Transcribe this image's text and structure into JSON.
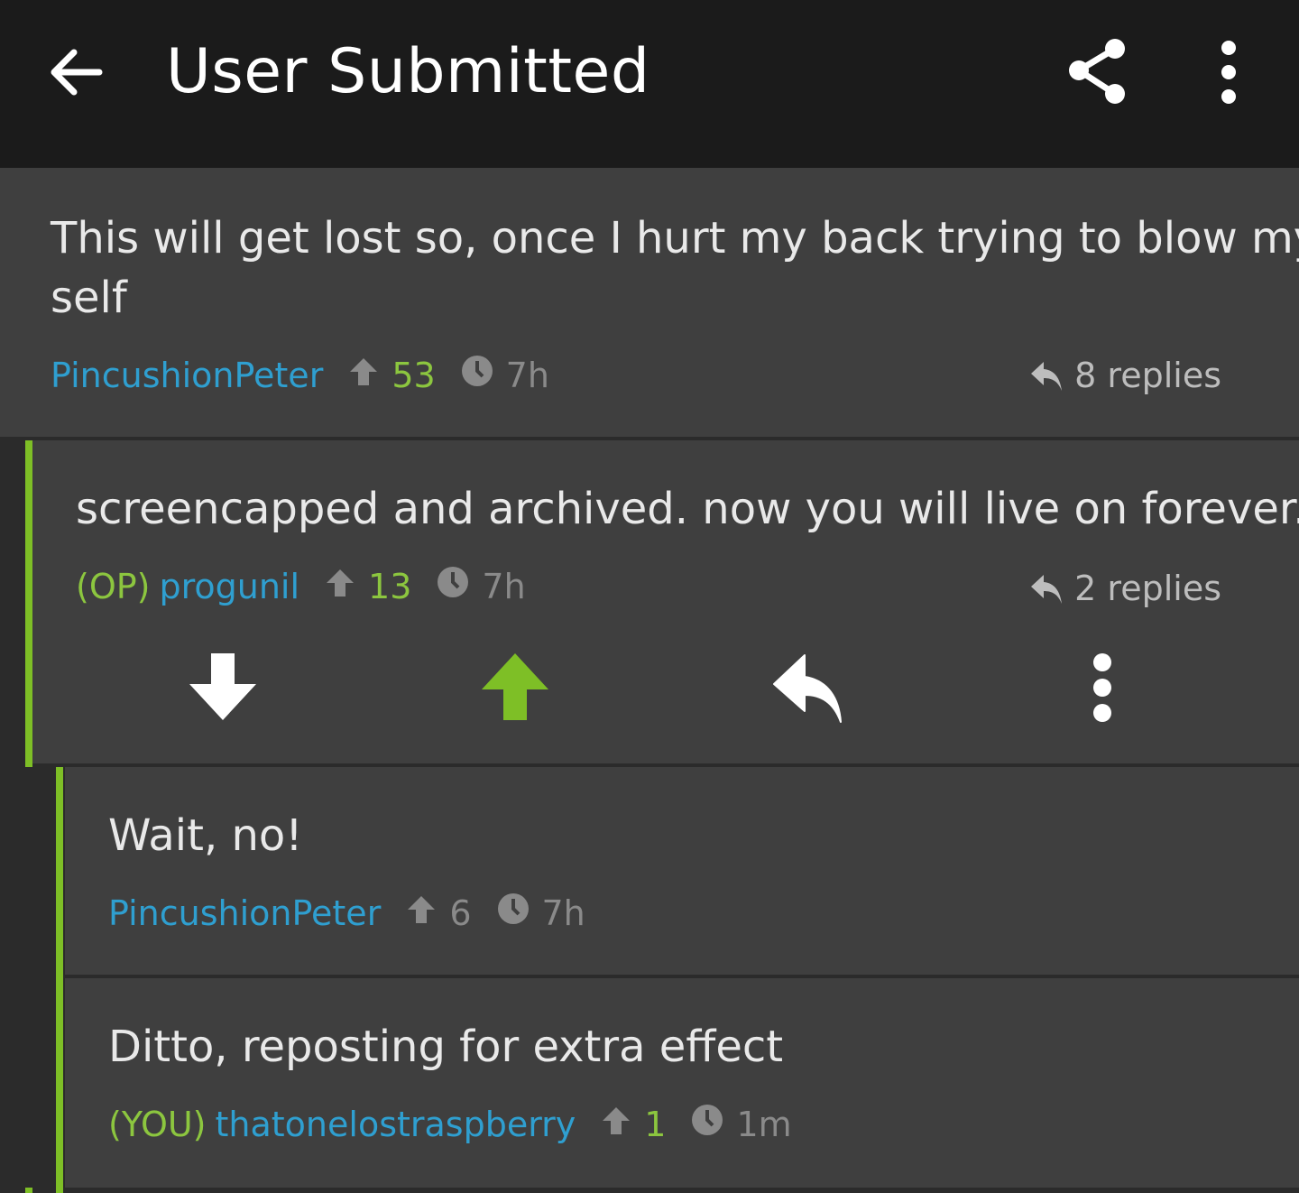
{
  "app_bar": {
    "title": "User Submitted",
    "back_icon": "arrow-left-icon",
    "share_icon": "share-icon",
    "overflow_icon": "more-vertical-icon"
  },
  "colors": {
    "app_bar_bg": "#1b1b1b",
    "comment_bg": "#3f3f3f",
    "accent_green": "#7ebf26",
    "author_blue": "#2f9fd0",
    "muted_gray": "#8a8a8a"
  },
  "comments": [
    {
      "text_line1": "This will get lost so, once I hurt my back trying to blow my",
      "text_line2": "self",
      "tag": "",
      "author": "PincushionPeter",
      "score": "53",
      "time": "7h",
      "replies": "8 replies"
    },
    {
      "text": "screencapped and archived. now you will live on forever.",
      "tag": "(OP)",
      "author": "progunil",
      "score": "13",
      "time": "7h",
      "replies": "2 replies",
      "actions": [
        "downvote-icon",
        "upvote-icon",
        "reply-icon",
        "more-vertical-icon"
      ]
    },
    {
      "text": "Wait, no!",
      "tag": "",
      "author": "PincushionPeter",
      "score": "6",
      "time": "7h"
    },
    {
      "text": "Ditto, reposting for extra effect",
      "tag": "(YOU)",
      "author": "thatonelostraspberry",
      "score": "1",
      "time": "1m"
    }
  ]
}
